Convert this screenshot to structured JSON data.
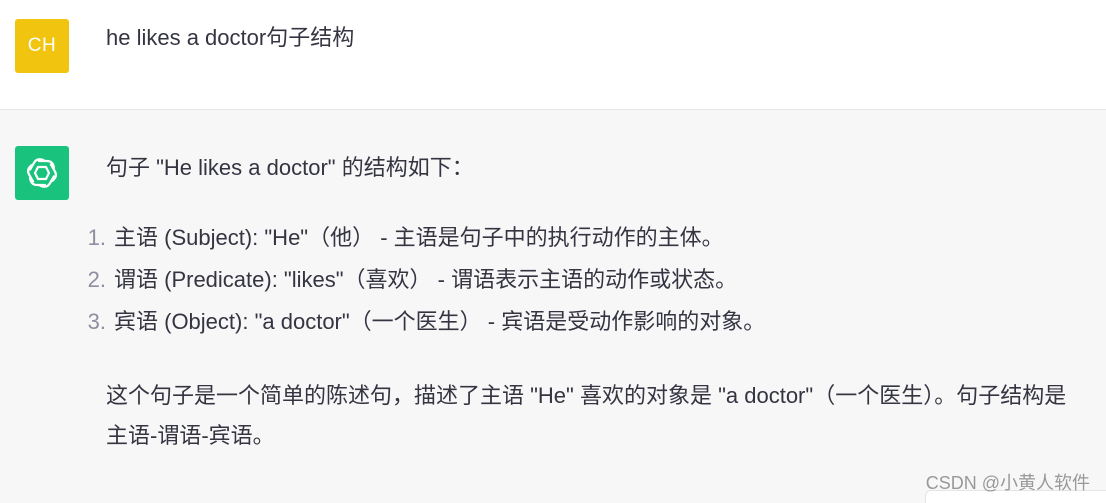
{
  "user_message": {
    "avatar_initials": "CH",
    "text": "he likes a doctor句子结构"
  },
  "assistant_message": {
    "avatar_icon": "openai-logo-icon",
    "intro": "句子 \"He likes a doctor\" 的结构如下：",
    "points": [
      {
        "number": "1.",
        "text": "主语 (Subject): \"He\"（他） - 主语是句子中的执行动作的主体。"
      },
      {
        "number": "2.",
        "text": "谓语 (Predicate): \"likes\"（喜欢） - 谓语表示主语的动作或状态。"
      },
      {
        "number": "3.",
        "text": "宾语 (Object): \"a doctor\"（一个医生） - 宾语是受动作影响的对象。"
      }
    ],
    "summary": "这个句子是一个简单的陈述句，描述了主语 \"He\" 喜欢的对象是 \"a doctor\"（一个医生）。句子结构是主语-谓语-宾语。"
  },
  "watermark": "CSDN @小黄人软件",
  "colors": {
    "user_avatar": "#f1c40f",
    "assistant_avatar": "#19c37d",
    "assistant_background": "#f7f7f8",
    "text": "#343541"
  }
}
